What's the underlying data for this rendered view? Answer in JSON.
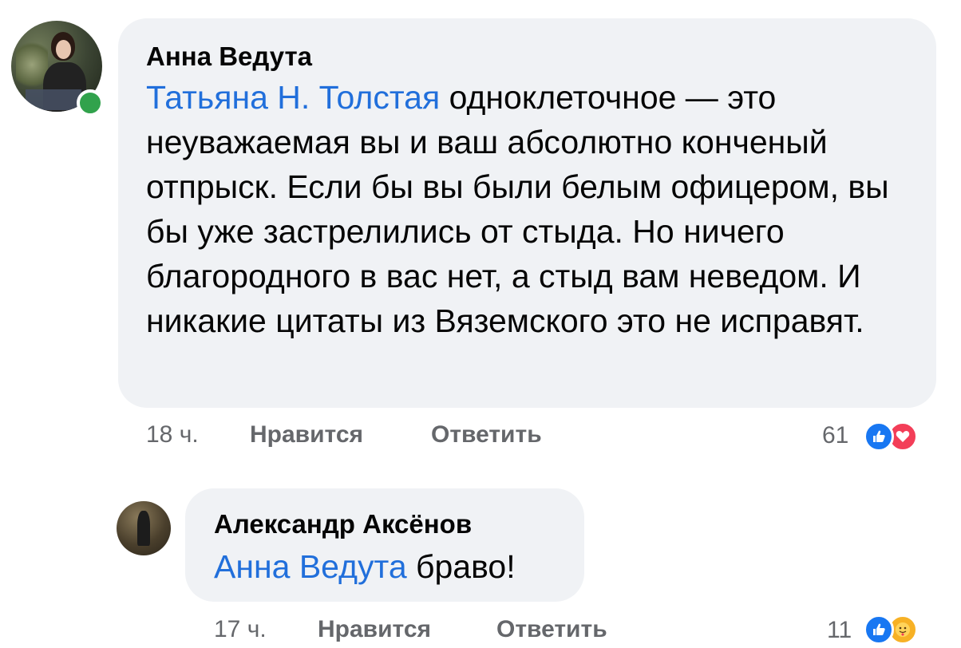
{
  "comments": [
    {
      "author": "Анна Ведута",
      "mention": "Татьяна Н. Толстая",
      "text": " одноклеточное — это неуважаемая вы и ваш абсолютно конченый отпрыск. Если бы вы были белым офицером, вы бы уже застрелились от стыда. Но ничего благородного в вас нет, а стыд вам неведом. И никакие цитаты из Вяземского это не исправят.",
      "time": "18 ч.",
      "like_label": "Нравится",
      "reply_label": "Ответить",
      "reaction_count": "61",
      "reactions": [
        "like-icon",
        "love-icon"
      ],
      "online": true
    },
    {
      "author": "Александр Аксёнов",
      "mention": "Анна Ведута",
      "text": " браво!",
      "time": "17 ч.",
      "like_label": "Нравится",
      "reply_label": "Ответить",
      "reaction_count": "11",
      "reactions": [
        "like-icon",
        "care-icon"
      ]
    }
  ],
  "colors": {
    "bubble": "#f0f2f5",
    "mention": "#216fdb",
    "meta": "#65676b",
    "like": "#1877f2",
    "love": "#f33e58",
    "care": "#f7b125",
    "online": "#31a24c"
  }
}
